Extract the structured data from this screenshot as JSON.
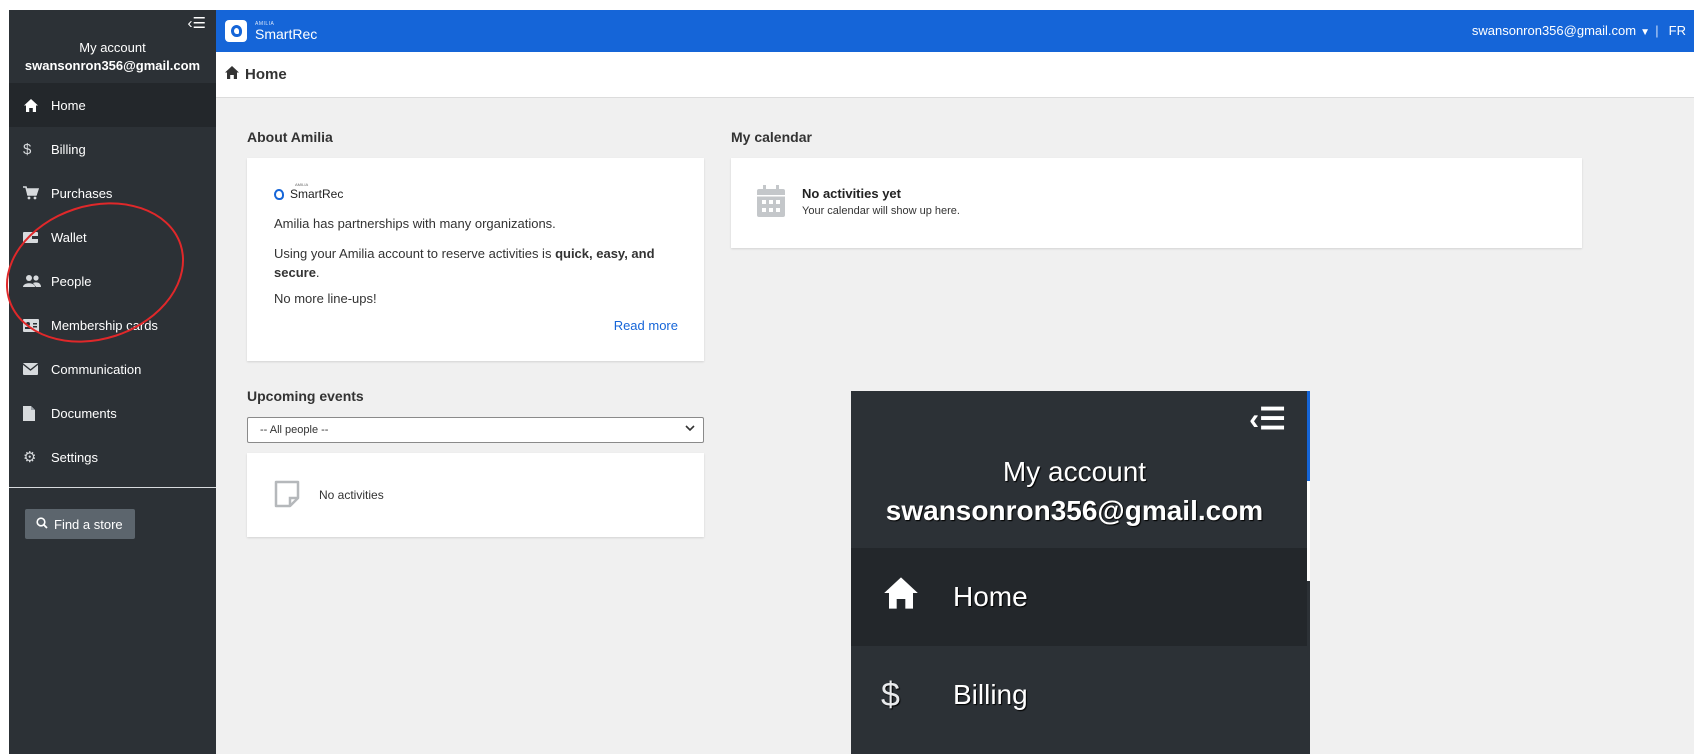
{
  "sidebar": {
    "collapse_icon": "collapse-menu-icon",
    "account_title": "My account",
    "account_email": "swansonron356@gmail.com",
    "items": [
      {
        "label": "Home",
        "icon": "home-icon",
        "active": true
      },
      {
        "label": "Billing",
        "icon": "dollar-icon"
      },
      {
        "label": "Purchases",
        "icon": "cart-icon"
      },
      {
        "label": "Wallet",
        "icon": "wallet-icon"
      },
      {
        "label": "People",
        "icon": "people-icon"
      },
      {
        "label": "Membership cards",
        "icon": "id-card-icon"
      },
      {
        "label": "Communication",
        "icon": "envelope-icon"
      },
      {
        "label": "Documents",
        "icon": "document-icon"
      },
      {
        "label": "Settings",
        "icon": "gear-icon"
      }
    ],
    "find_store_label": "Find a store"
  },
  "topbar": {
    "brand_small": "AMILIA",
    "brand": "SmartRec",
    "user_email": "swansonron356@gmail.com",
    "lang": "FR"
  },
  "breadcrumb": {
    "label": "Home"
  },
  "about": {
    "heading": "About Amilia",
    "logo_small": "AMILIA",
    "logo_text": "SmartRec",
    "line1": "Amilia has partnerships with many organizations.",
    "line2_pre": "Using your Amilia account to reserve activities is ",
    "line2_bold": "quick, easy, and secure",
    "line2_post": ".",
    "line3": "No more line-ups!",
    "read_more": "Read more"
  },
  "calendar": {
    "heading": "My calendar",
    "title": "No activities yet",
    "subtitle": "Your calendar will show up here."
  },
  "events": {
    "heading": "Upcoming events",
    "selected_filter": "-- All people --",
    "empty": "No activities"
  },
  "inset": {
    "account_title": "My account",
    "account_email": "swansonron356@gmail.com",
    "items": [
      {
        "label": "Home",
        "active": true
      },
      {
        "label": "Billing"
      }
    ]
  },
  "colors": {
    "sidebar_bg": "#2c3136",
    "topbar_bg": "#1565d8",
    "annotation": "#e0282a"
  }
}
